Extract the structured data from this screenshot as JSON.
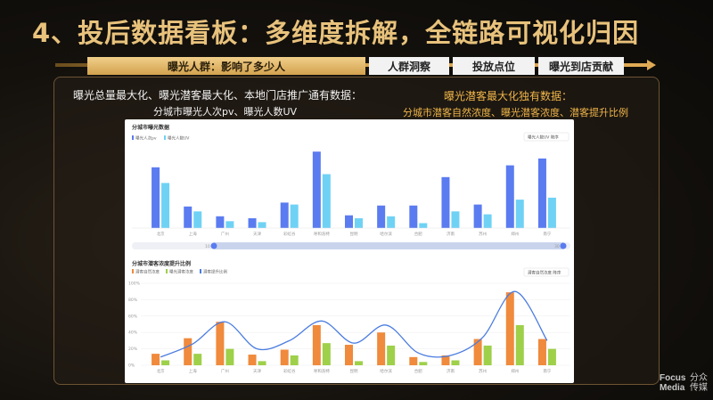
{
  "title": "4、投后数据看板：多维度拆解，全链路可视化归因",
  "tabs": [
    {
      "label": "曝光人群：影响了多少人",
      "active": true
    },
    {
      "label": "人群洞察",
      "active": false
    },
    {
      "label": "投放点位",
      "active": false
    },
    {
      "label": "曝光到店贡献",
      "active": false
    }
  ],
  "left_heading": "曝光总量最大化、曝光潜客最大化、本地门店推广通有数据：",
  "left_sub": "分城市曝光人次pv、曝光人数UV",
  "right_heading": "曝光潜客最大化独有数据：",
  "right_sub": "分城市潜客自然浓度、曝光潜客浓度、潜客提升比例",
  "colors": {
    "gold": "#e8c27c",
    "orange_text": "#f0b64a",
    "bar_blue_dark": "#5b7bf0",
    "bar_blue_light": "#6fd2f5",
    "bar_orange": "#f08a3c",
    "bar_green": "#9ed04a",
    "line_blue": "#4b7de0"
  },
  "chart_data": [
    {
      "type": "bar",
      "title": "分城市曝光数据",
      "legend": [
        "曝光人次pv",
        "曝光人数UV"
      ],
      "selector": "曝光人数UV 降序",
      "categories": [
        "北京",
        "上海",
        "广州",
        "天津",
        "彩虹谷",
        "呼和浩特",
        "昆明",
        "哈尔滨",
        "合肥",
        "济南",
        "苏州",
        "郑州",
        "南宁"
      ],
      "series": [
        {
          "name": "曝光人次pv",
          "values": [
            62,
            22,
            12,
            10,
            26,
            78,
            13,
            23,
            23,
            52,
            24,
            64,
            71
          ]
        },
        {
          "name": "曝光人数UV",
          "values": [
            46,
            17,
            7,
            6,
            24,
            55,
            10,
            12,
            5,
            17,
            14,
            29,
            31
          ]
        }
      ],
      "slider": {
        "start": "10",
        "end": "30"
      }
    },
    {
      "type": "bar",
      "title": "分城市潜客浓度提升比例",
      "legend": [
        "潜客自然浓度",
        "曝光潜客浓度",
        "潜客提升比例"
      ],
      "selector": "潜客自然浓度 降序",
      "yticks": [
        "0%",
        "20%",
        "40%",
        "60%",
        "80%",
        "100%"
      ],
      "ylim": [
        0,
        100
      ],
      "categories": [
        "北京",
        "上海",
        "广州",
        "天津",
        "彩虹谷",
        "呼和浩特",
        "昆明",
        "哈尔滨",
        "合肥",
        "济南",
        "苏州",
        "郑州",
        "南宁"
      ],
      "series": [
        {
          "name": "潜客自然浓度",
          "values": [
            14,
            33,
            53,
            13,
            19,
            49,
            25,
            40,
            10,
            12,
            32,
            89,
            32
          ]
        },
        {
          "name": "曝光潜客浓度",
          "values": [
            6,
            14,
            20,
            5,
            12,
            27,
            5,
            24,
            4,
            6,
            24,
            49,
            20
          ]
        },
        {
          "name": "潜客提升比例",
          "values": [
            10,
            26,
            53,
            20,
            30,
            54,
            27,
            49,
            15,
            12,
            34,
            90,
            30
          ]
        }
      ]
    }
  ],
  "logo": {
    "en1": "Focus",
    "en2": "Media",
    "cn1": "分众",
    "cn2": "传媒"
  }
}
